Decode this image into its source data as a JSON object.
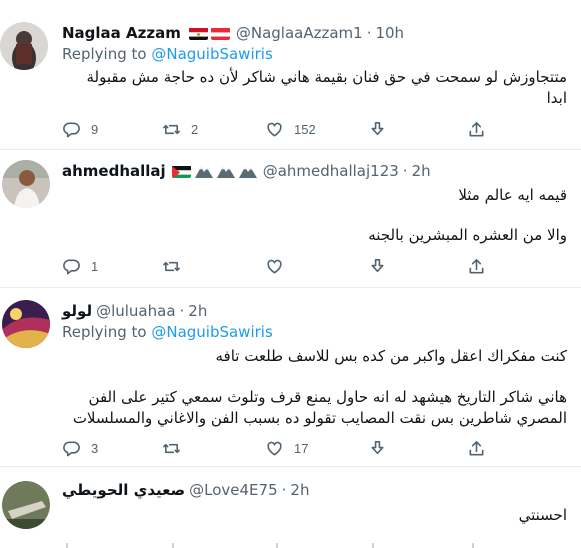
{
  "header": {
    "partial_title": ""
  },
  "tweets": [
    {
      "name": "Naglaa Azzam",
      "handle": "@NaglaaAzzam1",
      "time": "10h",
      "replying_prefix": "Replying to ",
      "replying_to": "@NaguibSawiris",
      "lines": [
        "متتجاوزش لو سمحت في حق فنان بقيمة هاني شاكر لأن ده حاجة مش مقبولة",
        "ابدا"
      ],
      "stats": {
        "replies": "9",
        "retweets": "2",
        "likes": "152"
      }
    },
    {
      "name": "ahmedhallaj",
      "handle": "@ahmedhallaj123",
      "time": "2h",
      "lines": [
        "قيمه ايه عالم مثلا",
        "والا من العشره المبشرين بالجنه"
      ],
      "stats": {
        "replies": "1",
        "retweets": "",
        "likes": ""
      }
    },
    {
      "name": "لولو",
      "handle": "@luluahaa",
      "time": "2h",
      "replying_prefix": "Replying to ",
      "replying_to": "@NaguibSawiris",
      "lines": [
        "كنت مفكراك اعقل واكبر من كده بس للاسف طلعت تافه",
        "هاني شاكر التاريخ هيشهد له انه حاول يمنع قرف وتلوث سمعي كتير على الفن",
        "المصري شاطرين بس نقت المصايب تقولو ده بسبب الفن والاغاني والمسلسلات"
      ],
      "stats": {
        "replies": "3",
        "retweets": "",
        "likes": "17"
      }
    },
    {
      "name": "صعيدي الحويطي",
      "handle": "@Love4E75",
      "time": "2h",
      "lines": [
        "احسنتي"
      ]
    }
  ],
  "colors": {
    "accent": "#1d9bf0",
    "muted": "#536471",
    "divider": "#e6ecf0"
  }
}
